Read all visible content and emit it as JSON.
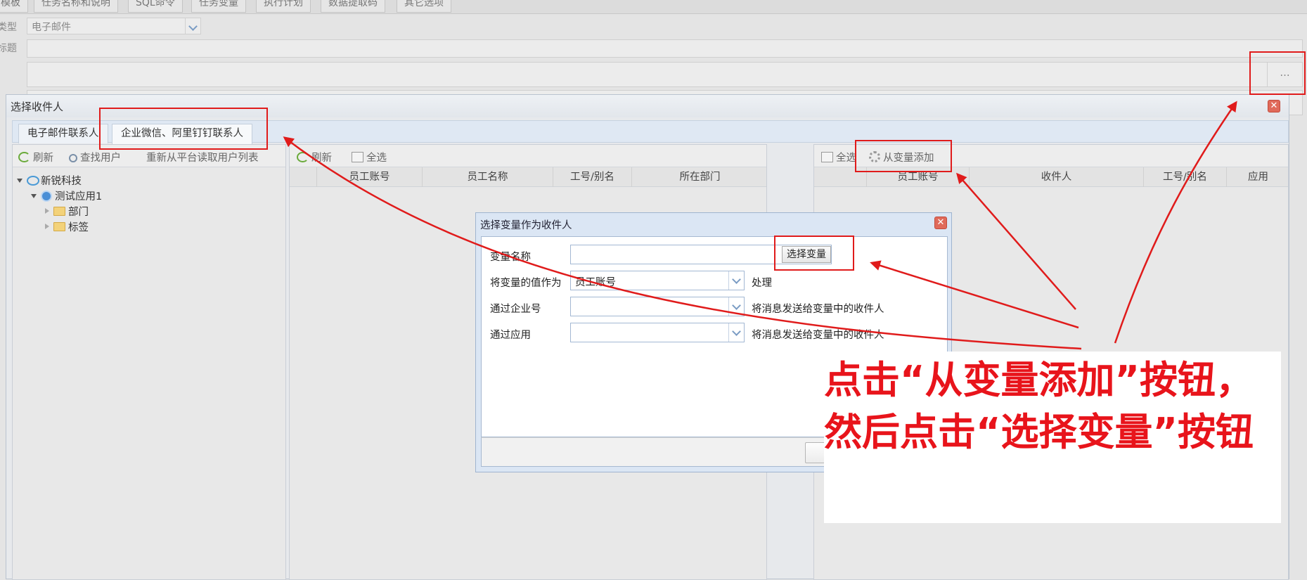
{
  "form": {
    "tabs": [
      "模板",
      "任务名称和说明",
      "SQL命令",
      "任务变量",
      "执行计划",
      "数据提取码",
      "其它选项"
    ],
    "type_label": "类型",
    "type_value": "电子邮件",
    "subject_label": "标题",
    "recipients_button": "..."
  },
  "dialog": {
    "title": "选择收件人",
    "tabs": [
      "电子邮件联系人",
      "企业微信、阿里钉钉联系人"
    ],
    "left_toolbar": [
      "刷新",
      "查找用户",
      "重新从平台读取用户列表"
    ],
    "tree": {
      "root": "新锐科技",
      "app": "测试应用1",
      "children": [
        "部门",
        "标签"
      ]
    },
    "middle_toolbar": [
      "刷新",
      "全选"
    ],
    "middle_columns": [
      "员工账号",
      "员工名称",
      "工号/别名",
      "所在部门"
    ],
    "right_toolbar": [
      "全选",
      "从变量添加"
    ],
    "right_columns": [
      "员工账号",
      "收件人",
      "工号/别名",
      "应用"
    ]
  },
  "sub_dialog": {
    "title": "选择变量作为收件人",
    "rows": [
      {
        "label": "变量名称",
        "value": "",
        "button": "选择变量"
      },
      {
        "label": "将变量的值作为",
        "value": "员工账号",
        "suffix": "处理"
      },
      {
        "label": "通过企业号",
        "value": "",
        "suffix": "将消息发送给变量中的收件人"
      },
      {
        "label": "通过应用",
        "value": "",
        "suffix": "将消息发送给变量中的收件人"
      }
    ]
  },
  "annotation": {
    "text": "点击“从变量添加”按钮，然后点击“选择变量”按钮",
    "color": "#e8141b"
  }
}
